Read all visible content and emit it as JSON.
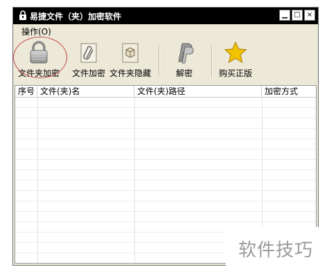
{
  "window": {
    "title": "易捷文件（夹）加密软件",
    "controls": {
      "minimize": "▁",
      "maximize": "□",
      "close": "×"
    }
  },
  "menu": {
    "operate": "操作(O)"
  },
  "toolbar": {
    "buttons": [
      {
        "label": "文件夹加密",
        "icon": "lock-icon"
      },
      {
        "label": "文件加密",
        "icon": "paperclip-document-icon"
      },
      {
        "label": "文件夹隐藏",
        "icon": "hidden-box-icon"
      },
      {
        "label": "解密",
        "icon": "paypal-p-icon"
      },
      {
        "label": "购买正版",
        "icon": "star-icon"
      }
    ]
  },
  "table": {
    "columns": [
      "序号",
      "文件(夹)名",
      "文件(夹)路径",
      "加密方式"
    ],
    "rows": []
  },
  "watermark": {
    "text": "软件技巧"
  },
  "colors": {
    "titlebar": "#000000",
    "window_bg": "#ece9d8",
    "highlight": "#c94a4a",
    "star": "#f2c400"
  }
}
